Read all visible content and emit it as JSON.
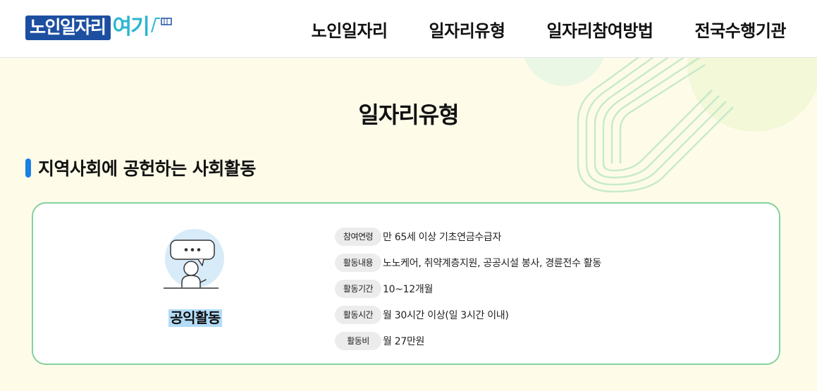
{
  "logo": {
    "main": "노인일자리",
    "sub": "여기"
  },
  "nav": {
    "items": [
      "노인일자리",
      "일자리유형",
      "일자리참여방법",
      "전국수행기관"
    ]
  },
  "page": {
    "title": "일자리유형"
  },
  "section": {
    "title": "지역사회에 공헌하는 사회활동"
  },
  "card": {
    "name": "공익활동",
    "rows": [
      {
        "label": "참여연령",
        "value": "만 65세 이상 기초연금수급자"
      },
      {
        "label": "활동내용",
        "value": "노노케어, 취약계층지원, 공공시설 봉사, 경륜전수 활동"
      },
      {
        "label": "활동기간",
        "value": "10~12개월"
      },
      {
        "label": "활동시간",
        "value": "월 30시간 이상(일 3시간 이내)"
      },
      {
        "label": "활동비",
        "value": "월 27만원"
      }
    ]
  },
  "colors": {
    "brand_blue": "#1d4fa1",
    "brand_cyan": "#2bb6cf",
    "accent_bar": "#1a7ee3",
    "card_border": "#84d19c",
    "highlight": "#b3dcf7",
    "background": "#fefce9"
  }
}
